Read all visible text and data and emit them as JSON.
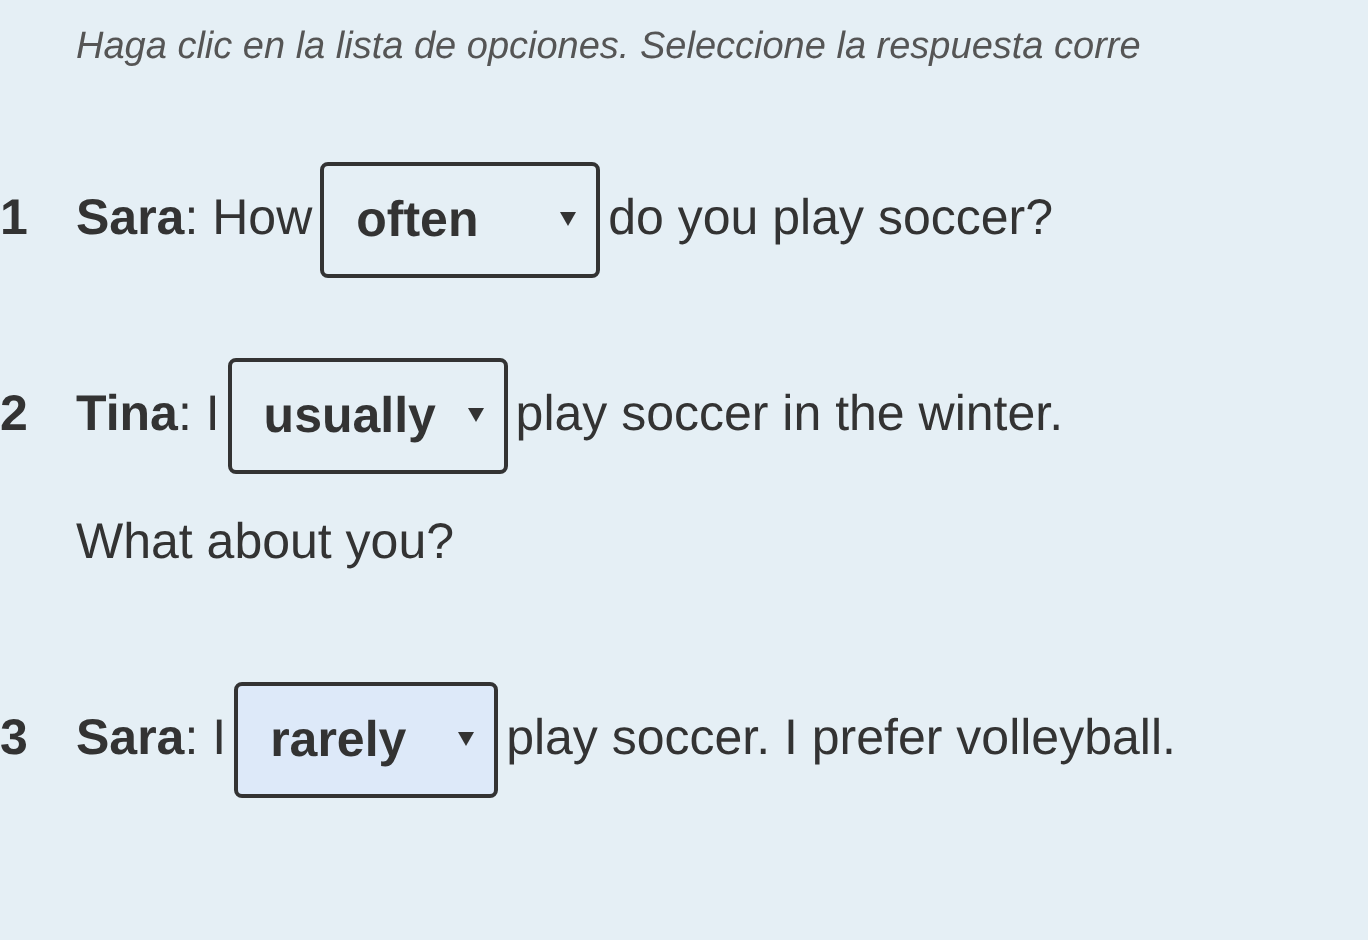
{
  "instruction": "Haga clic en la lista de opciones. Seleccione la respuesta corre",
  "items": [
    {
      "number": "1",
      "before": "**Sara**: How",
      "answer": "often",
      "focused": false,
      "after": "do you play soccer?"
    },
    {
      "number": "2",
      "before": "**Tina**: I",
      "answer": "usually",
      "focused": false,
      "after": "play soccer in the winter.",
      "next_line": "What about you?"
    },
    {
      "number": "3",
      "before": "**Sara**: I",
      "answer": "rarely",
      "focused": true,
      "after": "play soccer. I prefer volleyball."
    }
  ]
}
